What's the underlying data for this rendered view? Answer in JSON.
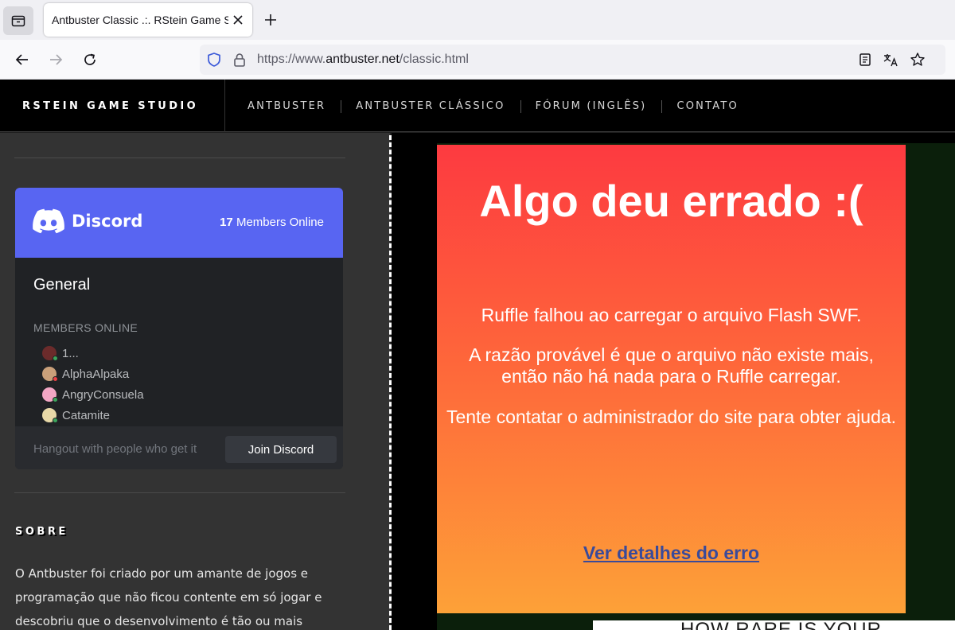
{
  "browser": {
    "tab_title": "Antbuster Classic .:. RStein Game Studio",
    "url_prefix": "https://www.",
    "url_domain": "antbuster.net",
    "url_path": "/classic.html"
  },
  "site": {
    "brand": "RSTEIN GAME STUDIO",
    "menu": [
      "ANTBUSTER",
      "ANTBUSTER CLÁSSICO",
      "FÓRUM (INGLÊS)",
      "CONTATO"
    ]
  },
  "discord": {
    "brand": "Discord",
    "online_count": "17",
    "online_label": "Members Online",
    "channel": "General",
    "members_title": "MEMBERS ONLINE",
    "members": [
      {
        "name": "1...",
        "avatar_color": "#6b2b2b",
        "status_color": "#3ba55c"
      },
      {
        "name": "AlphaAlpaka",
        "avatar_color": "#c9a07a",
        "status_color": "#ed4245"
      },
      {
        "name": "AngryConsuela",
        "avatar_color": "#f2a6c4",
        "status_color": "#3ba55c"
      },
      {
        "name": "Catamite",
        "avatar_color": "#e8d9a8",
        "status_color": "#3ba55c"
      }
    ],
    "footer_text": "Hangout with people who get it",
    "join_label": "Join Discord",
    "accent_color": "#5865f2"
  },
  "sobre": {
    "title": "SOBRE",
    "text": "O Antbuster foi criado por um amante de jogos e programação que não ficou contente em só jogar e descobriu que o desenvolvimento é tão ou mais divertido"
  },
  "ruffle": {
    "title": "Algo deu errado :(",
    "p1": "Ruffle falhou ao carregar o arquivo Flash SWF.",
    "p2": "A razão provável é que o arquivo não existe mais, então não há nada para o Ruffle carregar.",
    "p3": "Tente contatar o administrador do site para obter ajuda.",
    "link": "Ver detalhes do erro"
  },
  "banner": {
    "text": "HOW RARE IS YOUR"
  }
}
